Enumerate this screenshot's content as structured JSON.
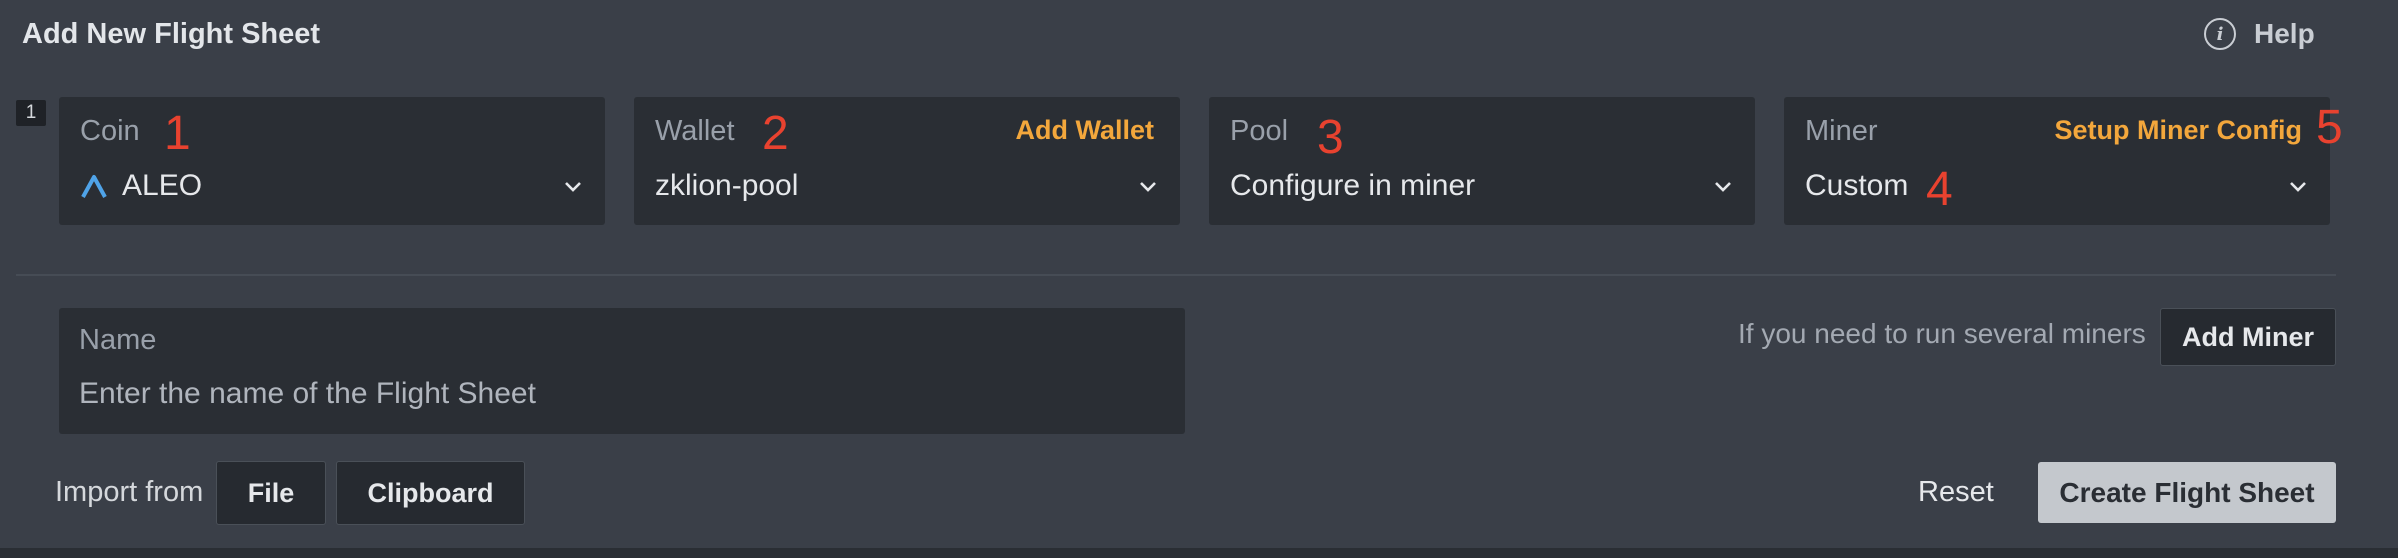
{
  "header": {
    "title": "Add New Flight Sheet",
    "help_label": "Help"
  },
  "row_number": "1",
  "fields": {
    "coin": {
      "label": "Coin",
      "value": "ALEO",
      "icon": "aleo-logo-icon"
    },
    "wallet": {
      "label": "Wallet",
      "value": "zklion-pool",
      "action": "Add Wallet"
    },
    "pool": {
      "label": "Pool",
      "value": "Configure in miner"
    },
    "miner": {
      "label": "Miner",
      "value": "Custom",
      "action": "Setup Miner Config"
    }
  },
  "annotations": [
    "1",
    "2",
    "3",
    "4",
    "5"
  ],
  "name_field": {
    "label": "Name",
    "placeholder": "Enter the name of the Flight Sheet",
    "value": ""
  },
  "add_miner": {
    "hint": "If you need to run several miners",
    "button": "Add Miner"
  },
  "import": {
    "label": "Import from",
    "file": "File",
    "clipboard": "Clipboard"
  },
  "footer": {
    "reset": "Reset",
    "create": "Create Flight Sheet"
  },
  "colors": {
    "background": "#3a3f48",
    "field": "#2a2e34",
    "accent": "#f3a73c",
    "annotation": "#e8422f",
    "coin_icon": "#4fa3e8"
  }
}
